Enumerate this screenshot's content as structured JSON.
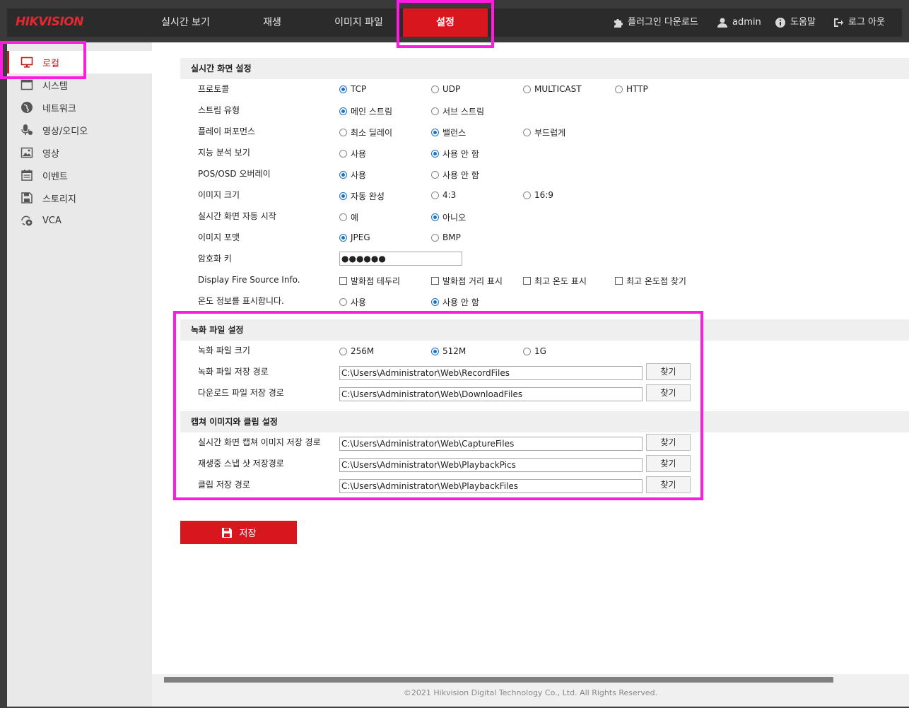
{
  "brand": {
    "logo_main": "HIK",
    "logo_rest": "VISION"
  },
  "nav": {
    "tabs": [
      {
        "label": "실시간 보기",
        "active": false
      },
      {
        "label": "재생",
        "active": false
      },
      {
        "label": "이미지 파일",
        "active": false
      },
      {
        "label": "설정",
        "active": true
      }
    ],
    "plugin_download": "플러그인 다운로드",
    "user": "admin",
    "help": "도움말",
    "logout": "로그 아웃"
  },
  "sidebar": {
    "items": [
      {
        "label": "로컬",
        "icon": "monitor-icon",
        "active": true
      },
      {
        "label": "시스템",
        "icon": "system-icon",
        "active": false
      },
      {
        "label": "네트워크",
        "icon": "globe-icon",
        "active": false
      },
      {
        "label": "영상/오디오",
        "icon": "mic-icon",
        "active": false
      },
      {
        "label": "영상",
        "icon": "image-icon",
        "active": false
      },
      {
        "label": "이벤트",
        "icon": "calendar-icon",
        "active": false
      },
      {
        "label": "스토리지",
        "icon": "storage-icon",
        "active": false
      },
      {
        "label": "VCA",
        "icon": "vca-icon",
        "active": false
      }
    ]
  },
  "live": {
    "header": "실시간 화면 설정",
    "rows": [
      {
        "label": "프로토콜",
        "type": "radio",
        "options": [
          "TCP",
          "UDP",
          "MULTICAST",
          "HTTP"
        ],
        "selected": 0
      },
      {
        "label": "스트림 유형",
        "type": "radio",
        "options": [
          "메인 스트림",
          "서브 스트림"
        ],
        "selected": 0
      },
      {
        "label": "플레이 퍼포먼스",
        "type": "radio",
        "options": [
          "최소 딜레이",
          "밸런스",
          "부드럽게"
        ],
        "selected": 1
      },
      {
        "label": "지능 분석 보기",
        "type": "radio",
        "options": [
          "사용",
          "사용 안 함"
        ],
        "selected": 1
      },
      {
        "label": "POS/OSD 오버레이",
        "type": "radio",
        "options": [
          "사용",
          "사용 안 함"
        ],
        "selected": 0
      },
      {
        "label": "이미지 크기",
        "type": "radio",
        "options": [
          "자동 완성",
          "4:3",
          "16:9"
        ],
        "selected": 0
      },
      {
        "label": "실시간 화면 자동 시작",
        "type": "radio",
        "options": [
          "예",
          "아니오"
        ],
        "selected": 1
      },
      {
        "label": "이미지 포맷",
        "type": "radio",
        "options": [
          "JPEG",
          "BMP"
        ],
        "selected": 0
      },
      {
        "label": "암호화 키",
        "type": "password",
        "value": "●●●●●●"
      },
      {
        "label": "Display Fire Source Info.",
        "type": "checkbox",
        "options": [
          "발화점 테두리",
          "발화점 거리 표시",
          "최고 온도 표시",
          "최고 온도점 찾기"
        ]
      },
      {
        "label": "온도 정보를 표시합니다.",
        "type": "radio",
        "options": [
          "사용",
          "사용 안 함"
        ],
        "selected": 1
      }
    ]
  },
  "record": {
    "header": "녹화 파일 설정",
    "size_label": "녹화 파일 크기",
    "size_options": [
      "256M",
      "512M",
      "1G"
    ],
    "size_selected": 1,
    "paths": [
      {
        "label": "녹화 파일 저장 경로",
        "value": "C:\\Users\\Administrator\\Web\\RecordFiles"
      },
      {
        "label": "다운로드 파일 저장 경로",
        "value": "C:\\Users\\Administrator\\Web\\DownloadFiles"
      }
    ]
  },
  "capture": {
    "header": "캡쳐 이미지와 클립 설정",
    "paths": [
      {
        "label": "실시간 화면 캡쳐 이미지 저장 경로",
        "value": "C:\\Users\\Administrator\\Web\\CaptureFiles"
      },
      {
        "label": "재생중 스냅 샷 저장경로",
        "value": "C:\\Users\\Administrator\\Web\\PlaybackPics"
      },
      {
        "label": "클립 저장 경로",
        "value": "C:\\Users\\Administrator\\Web\\PlaybackFiles"
      }
    ]
  },
  "browse_label": "찾기",
  "save_label": "저장",
  "footer": {
    "copyright": "©2021 Hikvision Digital Technology Co., Ltd. All Rights Reserved."
  },
  "colors": {
    "accent": "#d7161d",
    "highlight": "#ff1ce0",
    "radio": "#1a73c9"
  }
}
